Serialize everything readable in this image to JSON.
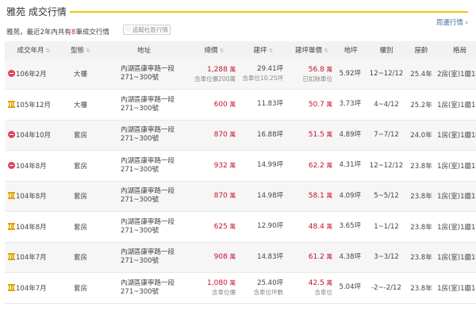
{
  "header": {
    "title": "雅苑 成交行情",
    "subtitle_prefix": "雅苑，最近2年內共有",
    "subtitle_count": "8",
    "subtitle_suffix": "筆成交行情",
    "follow_label": "追蹤社區行情",
    "nearby_label": "周邊行情",
    "accent_color": "#f3c300"
  },
  "table": {
    "columns": [
      "成交年月",
      "型態",
      "地址",
      "總價",
      "建坪",
      "建坪單價",
      "地坪",
      "樓別",
      "屋齡",
      "格局"
    ],
    "price_unit": "萬",
    "rows": [
      {
        "icon": "no-parking-icon",
        "date": "106年2月",
        "type": "大樓",
        "addr1": "內湖區康寧路一段",
        "addr2": "271~300號",
        "price": "1,288",
        "price_note": "含車位價200萬",
        "area": "29.41坪",
        "area_note": "含車位10.25坪",
        "unit_price": "56.8",
        "unit_note": "已扣除車位",
        "land": "5.92坪",
        "floor": "12~12/12",
        "age": "25.4年",
        "layout": "2房(室)1廳1衛"
      },
      {
        "icon": "bank-icon",
        "date": "105年12月",
        "type": "大樓",
        "addr1": "內湖區康寧路一段",
        "addr2": "271~300號",
        "price": "600",
        "price_note": "",
        "area": "11.83坪",
        "area_note": "",
        "unit_price": "50.7",
        "unit_note": "",
        "land": "3.73坪",
        "floor": "4~4/12",
        "age": "25.2年",
        "layout": "1房(室)1廳1衛"
      },
      {
        "icon": "no-parking-icon",
        "date": "104年10月",
        "type": "套房",
        "addr1": "內湖區康寧路一段",
        "addr2": "271~300號",
        "price": "870",
        "price_note": "",
        "area": "16.88坪",
        "area_note": "",
        "unit_price": "51.5",
        "unit_note": "",
        "land": "4.89坪",
        "floor": "7~7/12",
        "age": "24.0年",
        "layout": "1房(室)1廳1衛"
      },
      {
        "icon": "no-parking-icon",
        "date": "104年8月",
        "type": "套房",
        "addr1": "內湖區康寧路一段",
        "addr2": "271~300號",
        "price": "932",
        "price_note": "",
        "area": "14.99坪",
        "area_note": "",
        "unit_price": "62.2",
        "unit_note": "",
        "land": "4.31坪",
        "floor": "12~12/12",
        "age": "23.8年",
        "layout": "1房(室)1廳1衛"
      },
      {
        "icon": "bank-icon",
        "date": "104年8月",
        "type": "套房",
        "addr1": "內湖區康寧路一段",
        "addr2": "271~300號",
        "price": "870",
        "price_note": "",
        "area": "14.98坪",
        "area_note": "",
        "unit_price": "58.1",
        "unit_note": "",
        "land": "4.09坪",
        "floor": "5~5/12",
        "age": "23.8年",
        "layout": "1房(室)1廳1衛"
      },
      {
        "icon": "bank-icon",
        "date": "104年8月",
        "type": "套房",
        "addr1": "內湖區康寧路一段",
        "addr2": "271~300號",
        "price": "625",
        "price_note": "",
        "area": "12.90坪",
        "area_note": "",
        "unit_price": "48.4",
        "unit_note": "",
        "land": "3.65坪",
        "floor": "1~1/12",
        "age": "23.8年",
        "layout": "1房(室)1廳1衛"
      },
      {
        "icon": "bank-icon",
        "date": "104年7月",
        "type": "套房",
        "addr1": "內湖區康寧路一段",
        "addr2": "271~300號",
        "price": "908",
        "price_note": "",
        "area": "14.83坪",
        "area_note": "",
        "unit_price": "61.2",
        "unit_note": "",
        "land": "4.38坪",
        "floor": "3~3/12",
        "age": "23.8年",
        "layout": "1房(室)1廳1衛"
      },
      {
        "icon": "bank-icon",
        "date": "104年7月",
        "type": "套房",
        "addr1": "內湖區康寧路一段",
        "addr2": "271~300號",
        "price": "1,080",
        "price_note": "含車位價",
        "area": "25.40坪",
        "area_note": "含車位坪數",
        "unit_price": "42.5",
        "unit_note": "含車位",
        "land": "5.04坪",
        "floor": "-2~-2/12",
        "age": "23.8年",
        "layout": "1房(室)1廳1衛"
      }
    ]
  }
}
